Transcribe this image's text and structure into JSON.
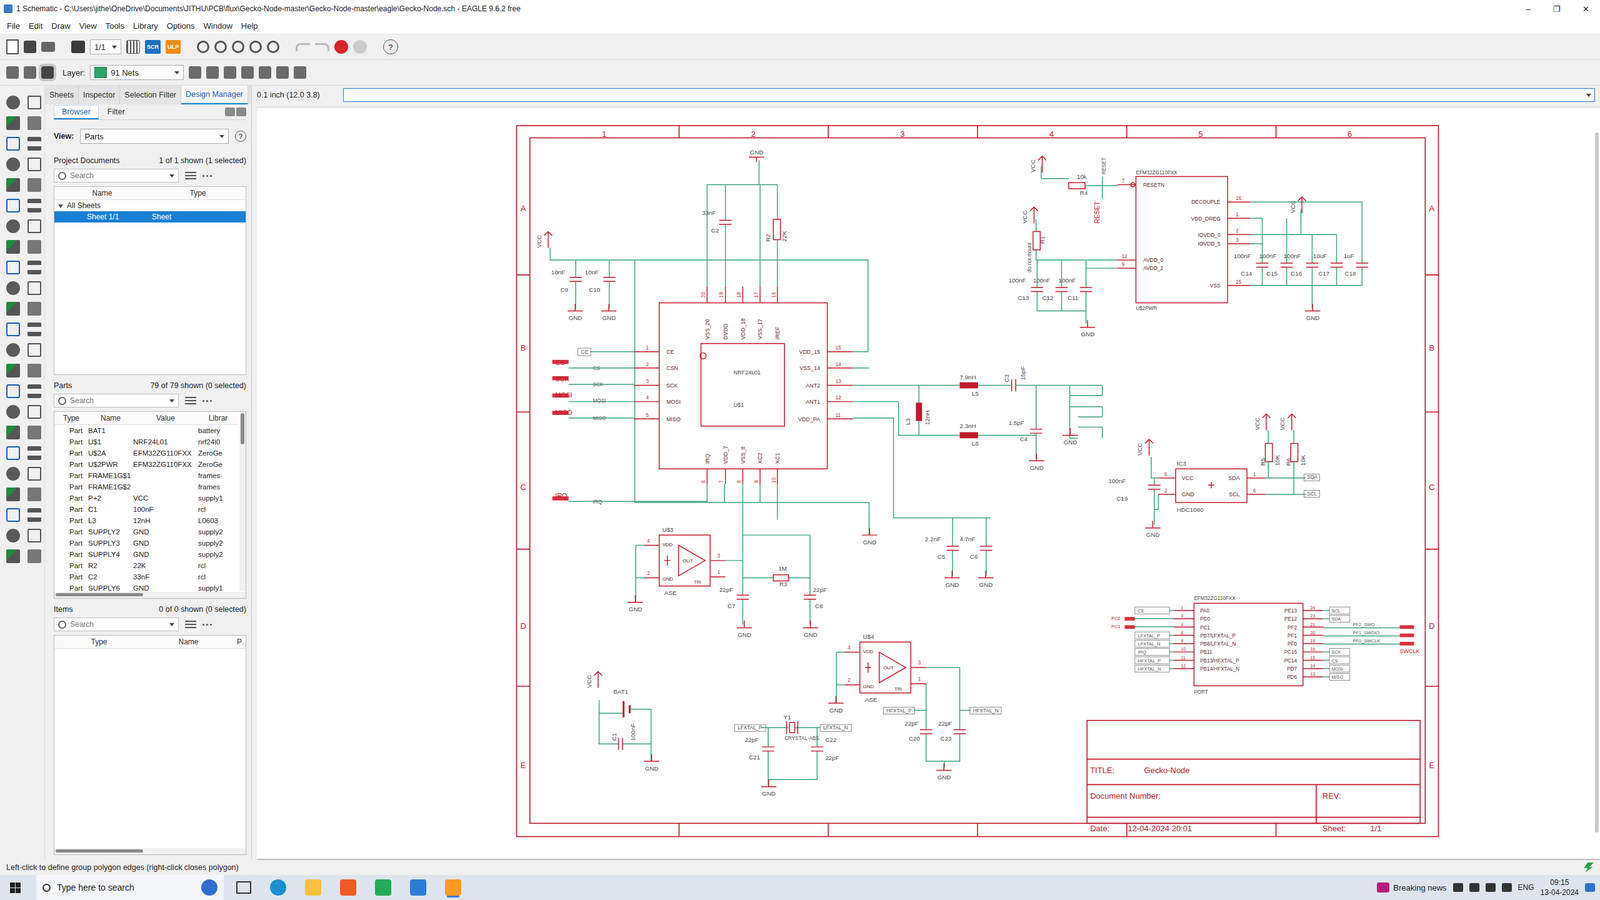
{
  "window": {
    "title": "1 Schematic - C:\\Users\\jithe\\OneDrive\\Documents\\JITHU\\PCB\\flux\\Gecko-Node-master\\Gecko-Node-master\\eagle\\Gecko-Node.sch - EAGLE 9.6.2 free",
    "controls": [
      "–",
      "❐",
      "✕"
    ]
  },
  "menu": [
    "File",
    "Edit",
    "Draw",
    "View",
    "Tools",
    "Library",
    "Options",
    "Window",
    "Help"
  ],
  "toolbar": {
    "sheet": "1/1",
    "script": "SCR",
    "ulp": "ULP",
    "help": "?",
    "layer_label": "Layer:",
    "layer": "91 Nets"
  },
  "panel": {
    "tabs": [
      {
        "label": "Sheets",
        "selected": false
      },
      {
        "label": "Inspector",
        "selected": false
      },
      {
        "label": "Selection Filter",
        "selected": false
      },
      {
        "label": "Design Manager",
        "selected": true
      }
    ],
    "subtabs": [
      {
        "label": "Browser",
        "selected": true
      },
      {
        "label": "Filter",
        "selected": false
      }
    ],
    "view_label": "View:",
    "view": "Parts",
    "help": "?",
    "documents": {
      "title": "Project Documents",
      "count": "1 of 1 shown (1 selected)",
      "search": "Search",
      "columns": [
        "Name",
        "Type"
      ],
      "tree": [
        {
          "name": "All Sheets",
          "type": "",
          "kind": "group",
          "expanded": true,
          "selected": false
        },
        {
          "name": "Sheet 1/1",
          "type": "Sheet",
          "kind": "item",
          "expanded": false,
          "selected": true
        }
      ]
    },
    "parts": {
      "title": "Parts",
      "count": "79 of 79 shown (0 selected)",
      "search": "Search",
      "columns": [
        "Type",
        "Name",
        "Value",
        "Librar"
      ],
      "rows": [
        [
          "Part",
          "BAT1",
          "",
          "battery"
        ],
        [
          "Part",
          "U$1",
          "NRF24L01",
          "nrf24l0"
        ],
        [
          "Part",
          "U$2A",
          "EFM32ZG110FXX",
          "ZeroGe"
        ],
        [
          "Part",
          "U$2PWR",
          "EFM32ZG110FXX",
          "ZeroGe"
        ],
        [
          "Part",
          "FRAME1G$1",
          "",
          "frames"
        ],
        [
          "Part",
          "FRAME1G$2",
          "",
          "frames"
        ],
        [
          "Part",
          "P+2",
          "VCC",
          "supply1"
        ],
        [
          "Part",
          "C1",
          "100nF",
          "rcl"
        ],
        [
          "Part",
          "L3",
          "12nH",
          "L0603"
        ],
        [
          "Part",
          "SUPPLY2",
          "GND",
          "supply2"
        ],
        [
          "Part",
          "SUPPLY3",
          "GND",
          "supply2"
        ],
        [
          "Part",
          "SUPPLY4",
          "GND",
          "supply2"
        ],
        [
          "Part",
          "R2",
          "22K",
          "rcl"
        ],
        [
          "Part",
          "C2",
          "33nF",
          "rcl"
        ],
        [
          "Part",
          "SUPPLY6",
          "GND",
          "supply1"
        ]
      ]
    },
    "items": {
      "title": "Items",
      "count": "0 of 0 shown (0 selected)",
      "search": "Search",
      "columns": [
        "Type",
        "Name",
        "P"
      ]
    }
  },
  "coordinate": "0.1 inch (12.0 3.8)",
  "schematic": {
    "frame": {
      "cols": [
        "1",
        "2",
        "3",
        "4",
        "5",
        "6"
      ],
      "rows": [
        "A",
        "B",
        "C",
        "D",
        "E"
      ]
    },
    "title_block": {
      "title_label": "TITLE:",
      "title": "Gecko-Node",
      "doc_label": "Document Number:",
      "rev_label": "REV:",
      "date_label": "Date:",
      "date": "12-04-2024 20:01",
      "sheet_label": "Sheet:",
      "sheet": "1/1"
    },
    "nrf": {
      "name": "U$1",
      "value": "NRF24L01",
      "left": [
        {
          "pin": "CE",
          "num": "1"
        },
        {
          "pin": "CSN",
          "num": "2"
        },
        {
          "pin": "SCK",
          "num": "3"
        },
        {
          "pin": "MOSI",
          "num": "4"
        },
        {
          "pin": "MISO",
          "num": "5"
        }
      ],
      "right": [
        {
          "pin": "VDD_15",
          "num": "15"
        },
        {
          "pin": "VSS_14",
          "num": "14"
        },
        {
          "pin": "ANT2",
          "num": "13"
        },
        {
          "pin": "ANT1",
          "num": "12"
        },
        {
          "pin": "VDD_PA",
          "num": "11"
        }
      ],
      "top": [
        {
          "pin": "VSS_20",
          "num": "20"
        },
        {
          "pin": "DVDD",
          "num": "19"
        },
        {
          "pin": "VDD_18",
          "num": "18"
        },
        {
          "pin": "VSS_17",
          "num": "17"
        },
        {
          "pin": "IREF",
          "num": "16"
        }
      ],
      "bottom": [
        {
          "pin": "IRQ",
          "num": "6"
        },
        {
          "pin": "VDD_7",
          "num": "7"
        },
        {
          "pin": "VSS_8",
          "num": "8"
        },
        {
          "pin": "XC2",
          "num": "9"
        },
        {
          "pin": "XC1",
          "num": "10"
        }
      ]
    },
    "oscillators": [
      {
        "name": "U$3",
        "value": "ASE",
        "pins": [
          "VDD",
          "GND",
          "OUT",
          "TRI"
        ],
        "nums": [
          "4",
          "2",
          "3",
          "1"
        ]
      },
      {
        "name": "U$4",
        "value": "ASE",
        "pins": [
          "VDD",
          "GND",
          "OUT",
          "TRI"
        ],
        "nums": [
          "4",
          "2",
          "3",
          "1"
        ]
      }
    ],
    "mcu_power": {
      "name": "EFM32ZG110FXX",
      "value": "U$2PWR",
      "left": [
        {
          "pin": "RESETN",
          "num": "7"
        },
        {
          "pin": "AVDD_0",
          "num": "12"
        },
        {
          "pin": "AVDD_2",
          "num": "9"
        }
      ],
      "right": [
        {
          "pin": "DECOUPLE",
          "num": "16"
        },
        {
          "pin": "VDD_DREG",
          "num": "1"
        },
        {
          "pin": "IOVDD_0",
          "num": "2"
        },
        {
          "pin": "IOVDD_5",
          "num": "3"
        },
        {
          "pin": "VSS",
          "num": "25"
        }
      ]
    },
    "sensor": {
      "name": "IC3",
      "value": "HDC1080",
      "left": [
        {
          "pin": "VCC",
          "num": "5"
        },
        {
          "pin": "GND",
          "num": "2"
        }
      ],
      "right": [
        {
          "pin": "SDA",
          "num": "1"
        },
        {
          "pin": "SCL",
          "num": "6"
        }
      ]
    },
    "port": {
      "name": "EFM32ZG110FXX",
      "value": "PORT",
      "connector": "SWCLK",
      "left": [
        {
          "pin": "PA0",
          "num": "1",
          "net": "CE",
          "kind": "label"
        },
        {
          "pin": "PC0",
          "num": "3",
          "net": "PC0",
          "kind": "pad"
        },
        {
          "pin": "PC1",
          "num": "4",
          "net": "PC1",
          "kind": "pad"
        },
        {
          "pin": "PB7/LFXTAL_P",
          "num": "8",
          "net": "LFXTAL_P",
          "kind": "label"
        },
        {
          "pin": "PB8/LFXTAL_N",
          "num": "9",
          "net": "LFXTAL_N",
          "kind": "label"
        },
        {
          "pin": "PB11",
          "num": "10",
          "net": "IRQ",
          "kind": "label"
        },
        {
          "pin": "PB13/HFXTAL_P",
          "num": "11",
          "net": "HFXTAL_P",
          "kind": "label"
        },
        {
          "pin": "PB14/HFXTAL_N",
          "num": "12",
          "net": "HFXTAL_N",
          "kind": "label"
        }
      ],
      "right": [
        {
          "pin": "PE13",
          "num": "24",
          "net": "SCL",
          "kind": "label"
        },
        {
          "pin": "PE12",
          "num": "23",
          "net": "SDA",
          "kind": "label"
        },
        {
          "pin": "PF2",
          "num": "21",
          "net": "PF2_SWO",
          "kind": "pad"
        },
        {
          "pin": "PF1",
          "num": "20",
          "net": "PF1_SWDIO",
          "kind": "pad"
        },
        {
          "pin": "PF0",
          "num": "19",
          "net": "PF0_SWCLK",
          "kind": "pad"
        },
        {
          "pin": "PC15",
          "num": "16",
          "net": "SCK",
          "kind": "label"
        },
        {
          "pin": "PC14",
          "num": "15",
          "net": "CS",
          "kind": "label"
        },
        {
          "pin": "PD7",
          "num": "14",
          "net": "MOSI",
          "kind": "label"
        },
        {
          "pin": "PD6",
          "num": "13",
          "net": "MISO",
          "kind": "label"
        }
      ]
    },
    "labels": [
      "GND",
      "33nF",
      "C2",
      "R2",
      "22K",
      "VCC",
      "10nF",
      "10nF",
      "C9",
      "C10",
      "GND",
      "GND",
      "CE",
      "CS",
      "CS",
      "SCK",
      "SCK",
      "MOSI",
      "MOSI",
      "MISO",
      "MISO",
      "IRQ",
      "IRQ",
      "7.9nH",
      "L5",
      "C3",
      "15pF",
      "L3",
      "12nH",
      "2.3nH",
      "L6",
      "1.5pF",
      "C4",
      "GND",
      "GND",
      "GND",
      "2.2nF",
      "C5",
      "4.7nF",
      "C6",
      "GND",
      "GND",
      "1M",
      "R3",
      "22pF",
      "C7",
      "22pF",
      "C8",
      "GND",
      "GND",
      "GND",
      "VCC",
      "BAT1",
      "C1",
      "100nF",
      "GND",
      "LFXTAL_P",
      "LFXTAL_N",
      "Y1",
      "CRYSTAL-ABS",
      "22pF",
      "C22",
      "C21",
      "22pF",
      "GND",
      "GND",
      "HFXTAL_P",
      "HFXTAL_N",
      "22pF",
      "22pF",
      "C20",
      "C23",
      "GND",
      "VCC",
      "10k",
      "R4",
      "RESET",
      "RESET",
      "VCC",
      "R1",
      "do not mount",
      "100nF",
      "100nF",
      "100nF",
      "C13",
      "C12",
      "C11",
      "GND",
      "VCC",
      "100nF",
      "100nF",
      "100nF",
      "10uF",
      "1uF",
      "C14",
      "C15",
      "C16",
      "C17",
      "C18",
      "GND",
      "VCC",
      "100nF",
      "C19",
      "GND",
      "VCC",
      "VCC",
      "R5",
      "10K",
      "R6",
      "10K",
      "SDA",
      "SCL"
    ]
  },
  "status": "Left-click to define group polygon edges (right-click closes polygon)",
  "taskbar": {
    "search": "Type here to search",
    "news": "Breaking news",
    "lang": "ENG",
    "time": "09:15",
    "date": "13-04-2024"
  }
}
